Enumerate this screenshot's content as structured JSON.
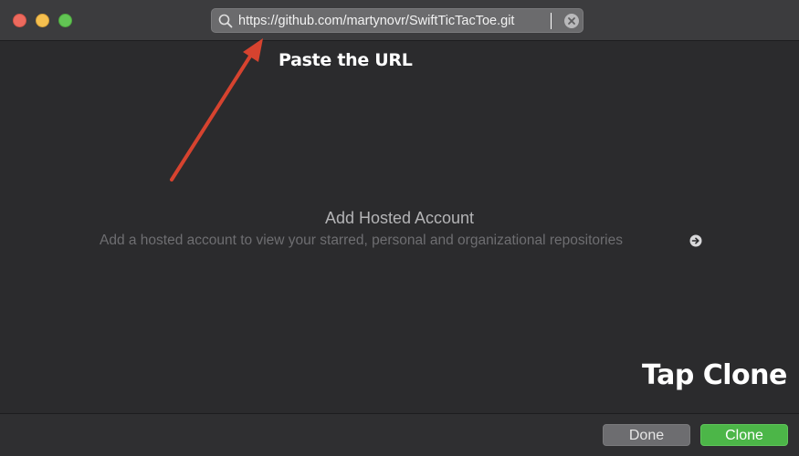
{
  "window": {
    "search": {
      "value": "https://github.com/martynovr/SwiftTicTacToe.git",
      "icon": "search-icon",
      "clear_icon": "clear-icon"
    }
  },
  "annotations": {
    "paste_label": "Paste the URL",
    "clone_label": "Tap Clone",
    "arrow_color": "#d6432f"
  },
  "empty_state": {
    "title": "Add Hosted Account",
    "subtitle": "Add a hosted account to view your starred, personal and organizational repositories",
    "icon": "arrow-circle-right-icon"
  },
  "footer": {
    "done_label": "Done",
    "clone_label": "Clone"
  },
  "colors": {
    "clone_button": "#4cb648",
    "traffic_close": "#ed6a5e",
    "traffic_minimize": "#f5bf4f",
    "traffic_zoom": "#62c554"
  }
}
